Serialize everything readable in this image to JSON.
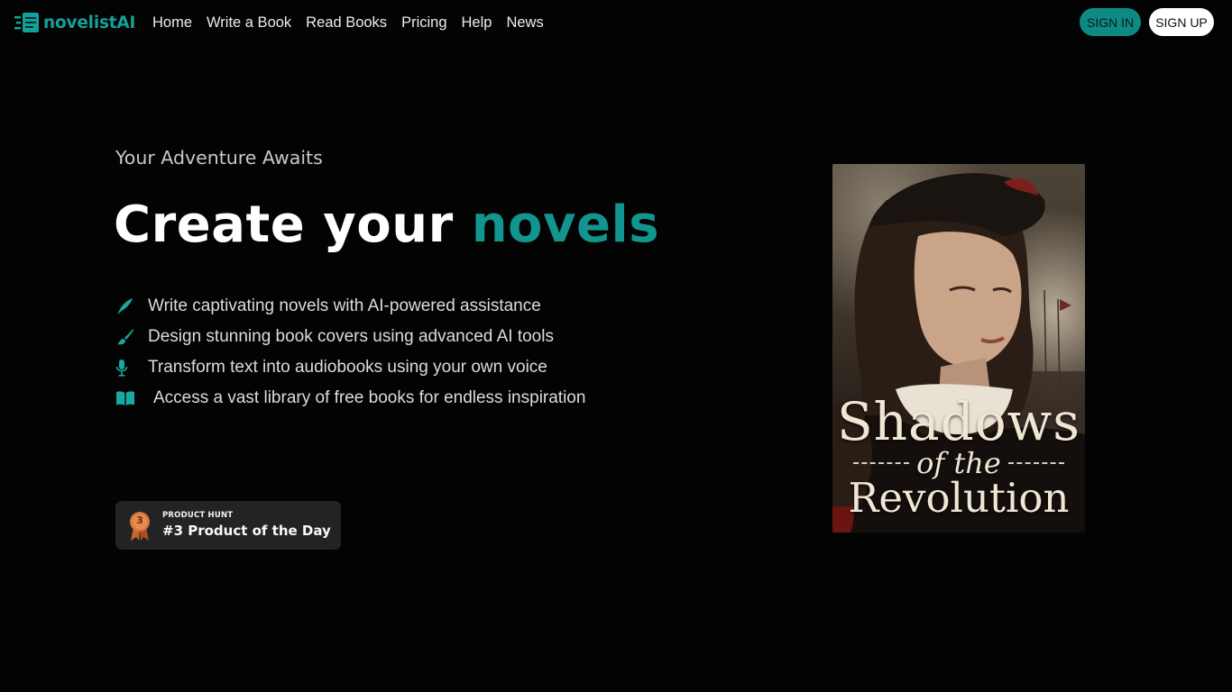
{
  "brand": {
    "name": "novelistAI",
    "accent_color": "#12958f"
  },
  "nav": {
    "items": [
      {
        "label": "Home"
      },
      {
        "label": "Write a Book"
      },
      {
        "label": "Read Books"
      },
      {
        "label": "Pricing"
      },
      {
        "label": "Help"
      },
      {
        "label": "News"
      }
    ]
  },
  "auth": {
    "sign_in": "SIGN IN",
    "sign_up": "SIGN UP"
  },
  "hero": {
    "eyebrow": "Your Adventure Awaits",
    "headline_prefix": "Create your ",
    "headline_accent": "novels",
    "features": [
      {
        "icon": "quill-pen-icon",
        "text": "Write captivating novels with AI-powered assistance"
      },
      {
        "icon": "paint-brush-icon",
        "text": "Design stunning book covers using advanced AI tools"
      },
      {
        "icon": "microphone-icon",
        "text": "Transform text into audiobooks using your own voice"
      },
      {
        "icon": "open-book-icon",
        "text": "Access a vast library of free books for endless inspiration"
      }
    ]
  },
  "badge": {
    "small": "PRODUCT HUNT",
    "big": "#3 Product of the Day",
    "rank": "3",
    "medal_color": "#c8662a"
  },
  "cover": {
    "title_line1": "Shadows",
    "title_line2": "of the",
    "title_line3": "Revolution"
  }
}
